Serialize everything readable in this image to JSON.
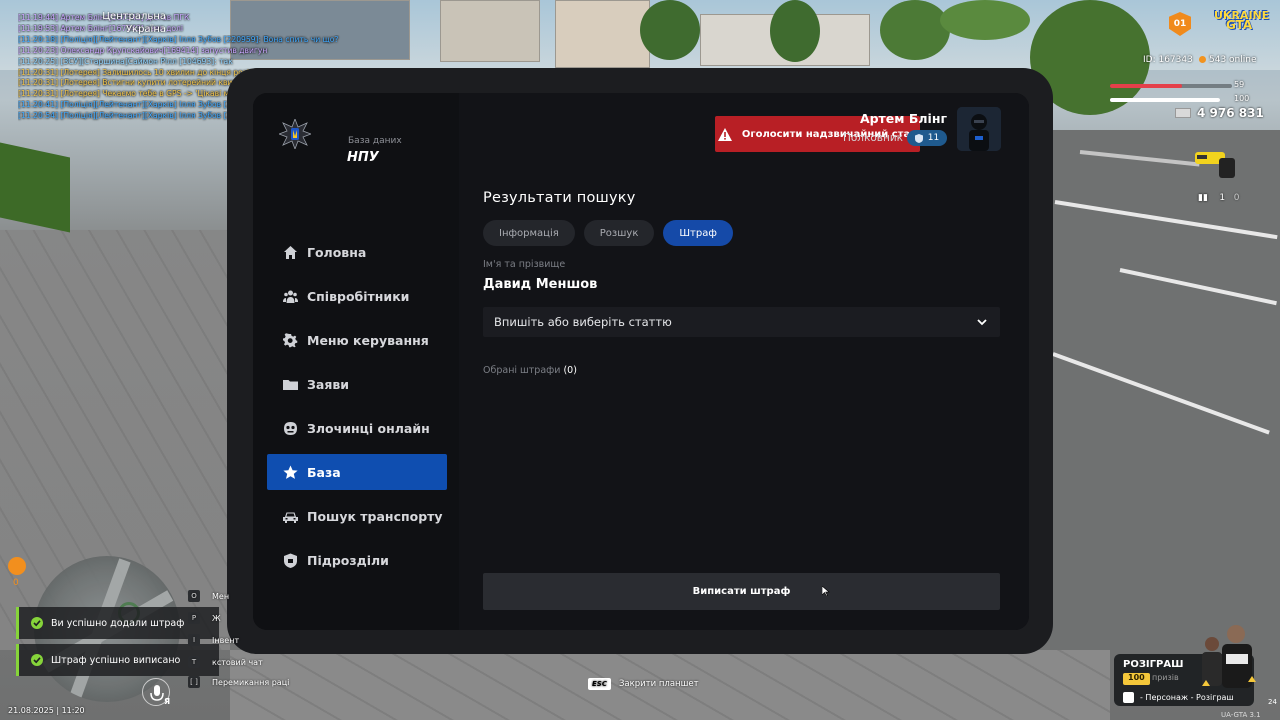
{
  "chat": [
    {
      "text": "[11:19:44] Артем Блінг[167343] дістав ПГК",
      "color": "#c9a6ff"
    },
    {
      "text": "[11:19:53] Артем Блінг[167343] взяв долі",
      "color": "#c9a6ff"
    },
    {
      "text": "[11:20:18] [Поліція][Лейтенант][Харків] Ілля Зубов [220959]: Вона спить чи що?",
      "color": "#3fa9ff"
    },
    {
      "text": "[11:20:23] Олександр Крупскайович[169414] запустив двигун",
      "color": "#c9a6ff"
    },
    {
      "text": "[11:20:25] [ЗСУ][Старшина]Саймон Рілл [104693]: так",
      "color": "#8ed3ff"
    },
    {
      "text": "[11:20:31] [Лотерея] Залишилось 10 хвилин до кінця розіграшу",
      "color": "#f0c34a"
    },
    {
      "text": "[11:20:31] [Лотерея] Встигни купити лотерейний квиток! Можливо ти станеш переможцем!",
      "color": "#f0c34a"
    },
    {
      "text": "[11:20:31] [Лотерея] Чекаємо тебе в GPS -> 'Цікаві місця' -> 'Казино'",
      "color": "#f0c34a"
    },
    {
      "text": "[11:20:41] [Поліція][Лейтенант][Харків] Ілля Зубов [220959]: Ми не можемо тоді з ним взаємодіяти",
      "color": "#3fa9ff",
      "rest_color": "#ffffff"
    },
    {
      "text": "[11:20:54] [Поліція][Лейтенант][Харків] Ілля Зубов [220959]: Треба очікувати поки проснеться",
      "color": "#3fa9ff",
      "rest_color": "#ffffff"
    }
  ],
  "hud": {
    "region_line1": "Центральна",
    "region_line2": "Україна",
    "region_code": "01",
    "logo_line1": "UKRAINE",
    "logo_line2": "GTA",
    "player_id": "ID: 167343",
    "online": "543 online",
    "health": "59",
    "armor": "100",
    "money": "4 976 831",
    "ammo_clip": "1",
    "ammo_total": "0",
    "health_color": "#e4404a",
    "armor_color": "#ffffff"
  },
  "tablet": {
    "brand_subtitle": "База даних",
    "brand_title": "НПУ",
    "nav": [
      {
        "label": "Головна",
        "icon": "home-icon",
        "active": false
      },
      {
        "label": "Співробітники",
        "icon": "users-icon",
        "active": false
      },
      {
        "label": "Меню керування",
        "icon": "gear-icon",
        "active": false
      },
      {
        "label": "Заяви",
        "icon": "folder-icon",
        "active": false
      },
      {
        "label": "Злочинці онлайн",
        "icon": "mask-icon",
        "active": false
      },
      {
        "label": "База",
        "icon": "star-icon",
        "active": true
      },
      {
        "label": "Пошук транспорту",
        "icon": "car-icon",
        "active": false
      },
      {
        "label": "Підрозділи",
        "icon": "shield-icon",
        "active": false
      }
    ],
    "alarm_button": "Оголосити надзвичайний стан",
    "user_name": "Артем Блінг",
    "user_rank": "Полковник",
    "user_rank_level": "11",
    "results_title": "Результати пошуку",
    "tabs": [
      {
        "label": "Інформація",
        "active": false
      },
      {
        "label": "Розшук",
        "active": false
      },
      {
        "label": "Штраф",
        "active": true
      }
    ],
    "name_label": "Ім'я та прізвище",
    "name_value": "Давид Меншов",
    "article_placeholder": "Впишіть або виберіть статтю",
    "selected_fines_label": "Обрані штрафи",
    "selected_fines_count": "(0)",
    "submit_button": "Виписати штраф",
    "accent_color": "#0f4eb0",
    "alarm_color": "#b81f25"
  },
  "toasts": [
    "Ви успішно додали штраф",
    "Штраф успішно виписано"
  ],
  "hints": [
    {
      "key": "O",
      "label": "Мен"
    },
    {
      "key": "P",
      "label": "Ж"
    },
    {
      "key": "I",
      "label": "Інвент"
    },
    {
      "key": "T",
      "label": "кстовий чат"
    },
    {
      "key": "[  ]",
      "label": "Перемикання раці"
    }
  ],
  "wrench_count": "0",
  "datetime": "21.08.2025 | 11:20",
  "mic_label": "Я",
  "esc_hint": {
    "key": "ESC",
    "label": "Закрити планшет"
  },
  "giveaway": {
    "title": "РОЗІГРАШ",
    "badge": "100",
    "prize_label": "призів",
    "footer": "- Персонаж - Розіграш"
  },
  "version": "UA-GTA 3.1",
  "corner_number": "24"
}
